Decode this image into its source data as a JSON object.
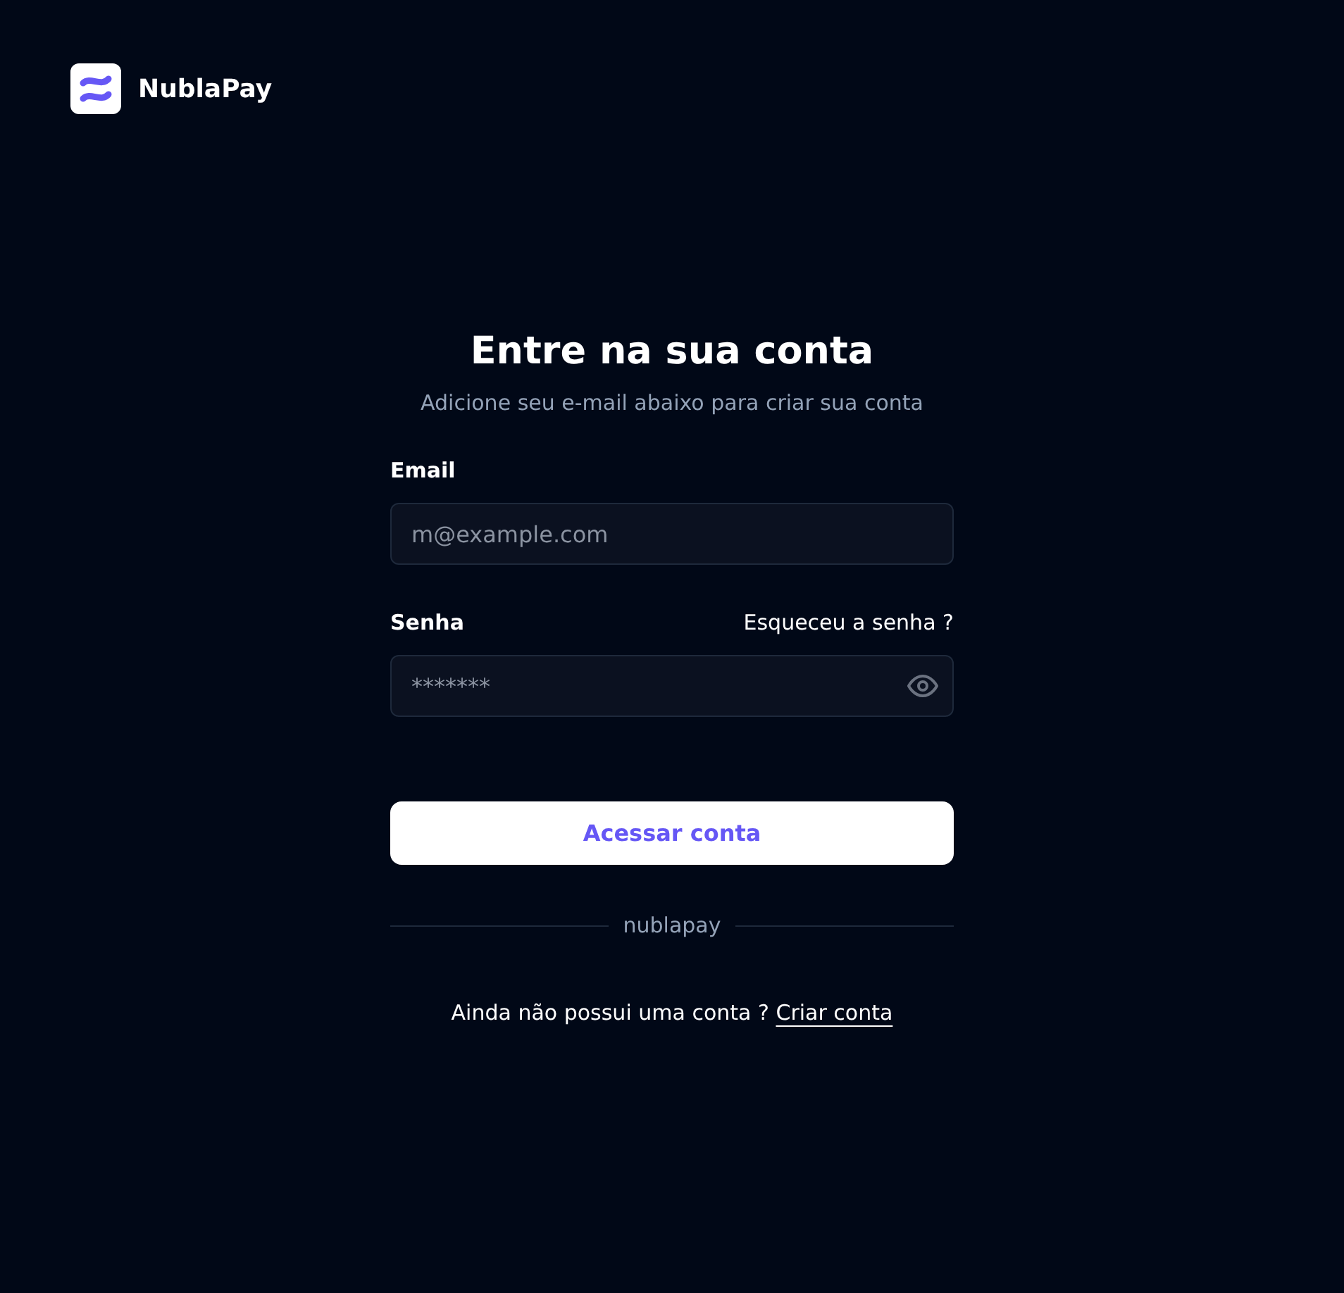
{
  "brand": {
    "name": "NublaPay"
  },
  "heading": "Entre na sua conta",
  "subtitle": "Adicione seu e-mail abaixo para criar sua conta",
  "email": {
    "label": "Email",
    "placeholder": "m@example.com"
  },
  "password": {
    "label": "Senha",
    "forgot_link": "Esqueceu a senha ?",
    "placeholder": "*******",
    "visible": false
  },
  "submit_button": "Acessar conta",
  "divider_text": "nublapay",
  "signup": {
    "text": "Ainda não possui uma conta ?",
    "link": "Criar conta"
  }
}
